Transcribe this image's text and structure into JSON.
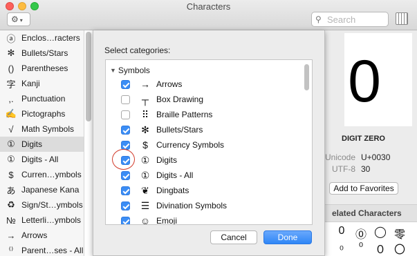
{
  "window": {
    "title": "Characters"
  },
  "toolbar": {
    "gear_icon": "gear-icon",
    "search_placeholder": "Search",
    "search_value": ""
  },
  "sidebar": {
    "items": [
      {
        "glyph": "ⓐ",
        "label": "Enclos…racters"
      },
      {
        "glyph": "✻",
        "label": "Bullets/Stars"
      },
      {
        "glyph": "()",
        "label": "Parentheses"
      },
      {
        "glyph": "字",
        "label": "Kanji"
      },
      {
        "glyph": ",.",
        "label": "Punctuation"
      },
      {
        "glyph": "✍",
        "label": "Pictographs"
      },
      {
        "glyph": "√",
        "label": "Math Symbols"
      },
      {
        "glyph": "①",
        "label": "Digits",
        "selected": true
      },
      {
        "glyph": "①",
        "label": "Digits - All"
      },
      {
        "glyph": "$",
        "label": "Curren…ymbols"
      },
      {
        "glyph": "あ",
        "label": "Japanese Kana"
      },
      {
        "glyph": "♻",
        "label": "Sign/St…ymbols"
      },
      {
        "glyph": "№",
        "label": "Letterli…ymbols"
      },
      {
        "glyph": "→",
        "label": "Arrows"
      },
      {
        "glyph": "⁽⁾",
        "label": "Parent…ses - All"
      }
    ]
  },
  "sheet": {
    "title": "Select categories:",
    "group_label": "Symbols",
    "categories": [
      {
        "glyph": "→",
        "label": "Arrows",
        "checked": true
      },
      {
        "glyph": "┬",
        "label": "Box Drawing",
        "checked": false
      },
      {
        "glyph": "⠿",
        "label": "Braille Patterns",
        "checked": false
      },
      {
        "glyph": "✻",
        "label": "Bullets/Stars",
        "checked": true
      },
      {
        "glyph": "$",
        "label": "Currency Symbols",
        "checked": true
      },
      {
        "glyph": "①",
        "label": "Digits",
        "checked": true
      },
      {
        "glyph": "①",
        "label": "Digits - All",
        "checked": true
      },
      {
        "glyph": "❦",
        "label": "Dingbats",
        "checked": true
      },
      {
        "glyph": "☰",
        "label": "Divination Symbols",
        "checked": true
      },
      {
        "glyph": "☺",
        "label": "Emoji",
        "checked": true
      }
    ],
    "cancel_label": "Cancel",
    "done_label": "Done"
  },
  "detail": {
    "glyph": "0",
    "name": "DIGIT ZERO",
    "unicode_key": "Unicode",
    "unicode_val": "U+0030",
    "utf8_key": "UTF-8",
    "utf8_val": "30",
    "favorites_label": "Add to Favorites",
    "related_header": "elated Characters",
    "related": [
      "0",
      "⓪",
      "◯",
      "零",
      "₀",
      "⁰",
      "０",
      "〇"
    ]
  },
  "colors": {
    "accent": "#3b8df5",
    "annotation": "#d23a2a"
  }
}
